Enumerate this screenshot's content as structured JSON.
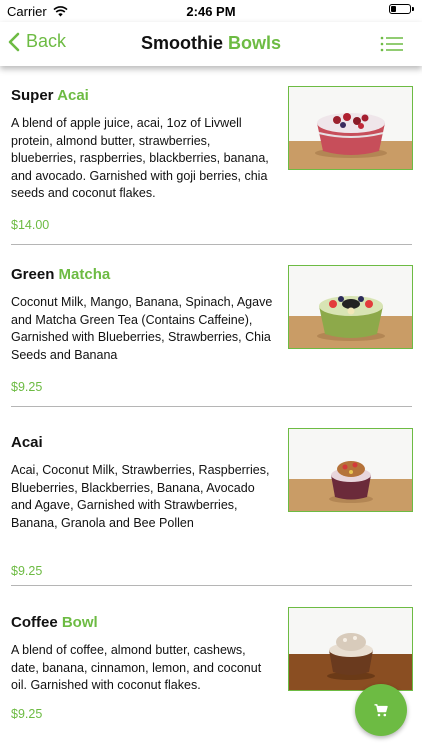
{
  "status_bar": {
    "carrier": "Carrier",
    "time": "2:46 PM",
    "battery_level": 0.25
  },
  "nav": {
    "back_label": "Back",
    "title_main": "Smoothie",
    "title_accent": "Bowls",
    "menu_icon": "list-menu-icon"
  },
  "colors": {
    "accent": "#6dbb43",
    "divider": "#b5b5b5"
  },
  "items": [
    {
      "title_main": "Super",
      "title_accent": "Acai",
      "description": "A blend of apple juice, acai, 1oz of Livwell protein, almond butter, strawberries, blueberries, raspberries, blackberries, banana, and avocado. Garnished with goji berries, chia seeds and coconut flakes.",
      "price": "$14.00"
    },
    {
      "title_main": "Green",
      "title_accent": "Matcha",
      "description": "Coconut Milk, Mango, Banana, Spinach, Agave and Matcha Green Tea (Contains Caffeine), Garnished with Blueberries, Strawberries, Chia Seeds and Banana",
      "price": "$9.25"
    },
    {
      "title_main": "Acai",
      "title_accent": "",
      "description": "Acai, Coconut Milk, Strawberries, Raspberries, Blueberries, Blackberries, Banana, Avocado and Agave, Garnished with Strawberries, Banana, Granola and Bee Pollen",
      "price": "$9.25"
    },
    {
      "title_main": "Coffee",
      "title_accent": "Bowl",
      "description": "A blend of coffee, almond butter, cashews, date, banana, cinnamon, lemon, and coconut oil. Garnished with coconut flakes.",
      "price": "$9.25"
    }
  ],
  "cart": {
    "icon": "shopping-cart-icon"
  }
}
